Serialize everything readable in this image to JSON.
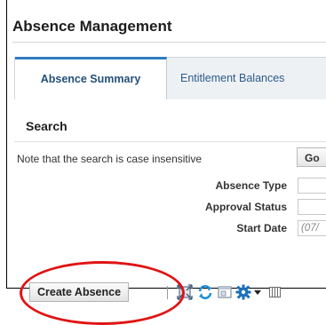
{
  "page": {
    "title": "Absence Management"
  },
  "tabs": [
    {
      "label": "Absence Summary",
      "active": true
    },
    {
      "label": "Entitlement Balances",
      "active": false
    }
  ],
  "search": {
    "title": "Search",
    "note": "Note that the search is case insensitive",
    "fields": [
      {
        "label": "Absence Type",
        "value": "",
        "placeholder": ""
      },
      {
        "label": "Approval Status",
        "value": "",
        "placeholder": ""
      },
      {
        "label": "Start Date",
        "value": "",
        "placeholder": "(07/"
      }
    ],
    "go_label": "Go"
  },
  "toolbar": {
    "create_label": "Create Absence",
    "icons": [
      "detach-icon",
      "refresh-icon",
      "freeze-icon",
      "gear-icon",
      "chevron-down-icon",
      "columns-icon"
    ]
  },
  "colors": {
    "accent": "#2f7cc0",
    "tab_text": "#2b5a89",
    "highlight": "#e01414",
    "refresh_icon": "#1d8fd8",
    "gear_icon": "#1b6fb9"
  }
}
